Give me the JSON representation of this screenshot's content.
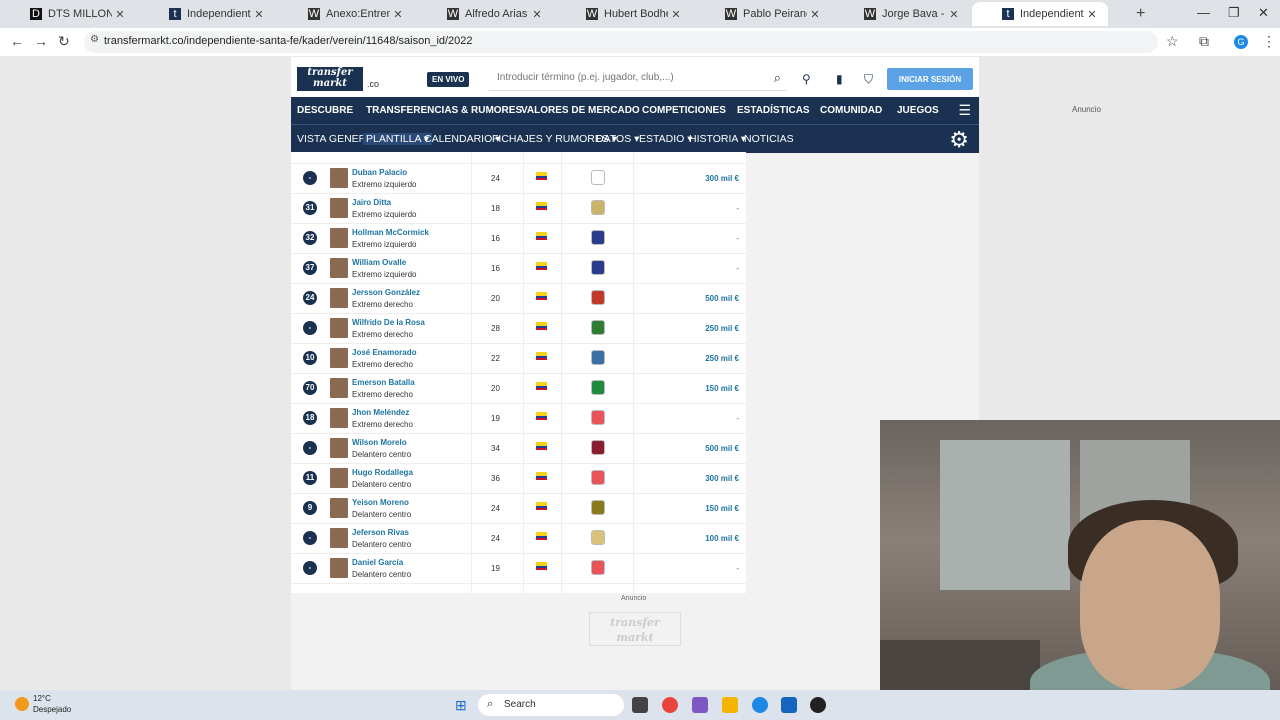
{
  "browser": {
    "tabs": [
      {
        "label": "DTS MILLONARIOS | Tierr",
        "favicon": "D",
        "color": "#111111"
      },
      {
        "label": "Independiente Santa Fe",
        "favicon": "t",
        "color": "#1a3151"
      },
      {
        "label": "Anexo:Entrenadores del",
        "favicon": "W",
        "color": "#333333"
      },
      {
        "label": "Alfredo Arias (entrenador",
        "favicon": "W",
        "color": "#333333"
      },
      {
        "label": "Hubert Bodhert - Wikipedi",
        "favicon": "W",
        "color": "#333333"
      },
      {
        "label": "Pablo Peirano - Wikipedi",
        "favicon": "W",
        "color": "#333333"
      },
      {
        "label": "Jorge Bava - Wikipedia, la",
        "favicon": "W",
        "color": "#333333"
      },
      {
        "label": "Independiente Santa Fe",
        "favicon": "t",
        "color": "#1a3151"
      }
    ],
    "url": "transfermarkt.co/independiente-santa-fe/kader/verein/11648/saison_id/2022"
  },
  "header": {
    "logo_text": "transfer markt",
    "domain_suffix": ".co",
    "live_label": "EN VIVO",
    "search_placeholder": "Introducir término (p.ej. jugador, club,...)",
    "login_label": "INICIAR SESIÓN"
  },
  "main_nav": [
    "DESCUBRE",
    "TRANSFERENCIAS & RUMORES",
    "VALORES DE MERCADO",
    "COMPETICIONES",
    "ESTADÍSTICAS",
    "COMUNIDAD",
    "JUEGOS"
  ],
  "sub_nav": [
    "VISTA GENERAL",
    "PLANTILLA",
    "CALENDARIO",
    "FICHAJES Y RUMORES",
    "DATOS",
    "ESTADIO",
    "HISTORIA",
    "NOTICIAS"
  ],
  "players": [
    {
      "num": "-",
      "name": "Duban Palacio",
      "position": "Extremo izquierdo",
      "age": "24",
      "value": "300 mil €",
      "club_color": "#ffffff",
      "club_glyph": "◎"
    },
    {
      "num": "31",
      "name": "Jairo Ditta",
      "position": "Extremo izquierdo",
      "age": "18",
      "value": "-",
      "club_color": "#c8b46a",
      "club_glyph": ""
    },
    {
      "num": "32",
      "name": "Hollman McCormick",
      "position": "Extremo izquierdo",
      "age": "16",
      "value": "-",
      "club_color": "#2a3c8c",
      "club_glyph": ""
    },
    {
      "num": "37",
      "name": "William Ovalle",
      "position": "Extremo izquierdo",
      "age": "16",
      "value": "-",
      "club_color": "#2a3c8c",
      "club_glyph": ""
    },
    {
      "num": "24",
      "name": "Jersson González",
      "position": "Extremo derecho",
      "age": "20",
      "value": "500 mil €",
      "club_color": "#c0392b",
      "club_glyph": ""
    },
    {
      "num": "-",
      "name": "Wilfrido De la Rosa",
      "position": "Extremo derecho",
      "age": "28",
      "value": "250 mil €",
      "club_color": "#2e7d32",
      "club_glyph": ""
    },
    {
      "num": "10",
      "name": "José Enamorado",
      "position": "Extremo derecho",
      "age": "22",
      "value": "250 mil €",
      "club_color": "#3a6ea5",
      "club_glyph": ""
    },
    {
      "num": "70",
      "name": "Emerson Batalla",
      "position": "Extremo derecho",
      "age": "20",
      "value": "150 mil €",
      "club_color": "#1e8a3e",
      "club_glyph": ""
    },
    {
      "num": "18",
      "name": "Jhon Meléndez",
      "position": "Extremo derecho",
      "age": "19",
      "value": "-",
      "club_color": "#e8545a",
      "club_glyph": ""
    },
    {
      "num": "-",
      "name": "Wilson Morelo",
      "position": "Delantero centro",
      "age": "34",
      "value": "500 mil €",
      "club_color": "#8b1e2e",
      "club_glyph": ""
    },
    {
      "num": "11",
      "name": "Hugo Rodallega",
      "position": "Delantero centro",
      "age": "36",
      "value": "300 mil €",
      "club_color": "#e8545a",
      "club_glyph": ""
    },
    {
      "num": "9",
      "name": "Yeison Moreno",
      "position": "Delantero centro",
      "age": "24",
      "value": "150 mil €",
      "club_color": "#8a7a1a",
      "club_glyph": ""
    },
    {
      "num": "-",
      "name": "Jeferson Rivas",
      "position": "Delantero centro",
      "age": "24",
      "value": "100 mil €",
      "club_color": "#d9c27a",
      "club_glyph": ""
    },
    {
      "num": "-",
      "name": "Daniel García",
      "position": "Delantero centro",
      "age": "19",
      "value": "-",
      "club_color": "#e8545a",
      "club_glyph": ""
    }
  ],
  "ad_label_mid": "Anuncio",
  "ad_label_right": "Anuncio",
  "watermark": "transfer markt",
  "taskbar": {
    "weather_temp": "12°C",
    "weather_desc": "Despejado",
    "search_label": "Search"
  }
}
